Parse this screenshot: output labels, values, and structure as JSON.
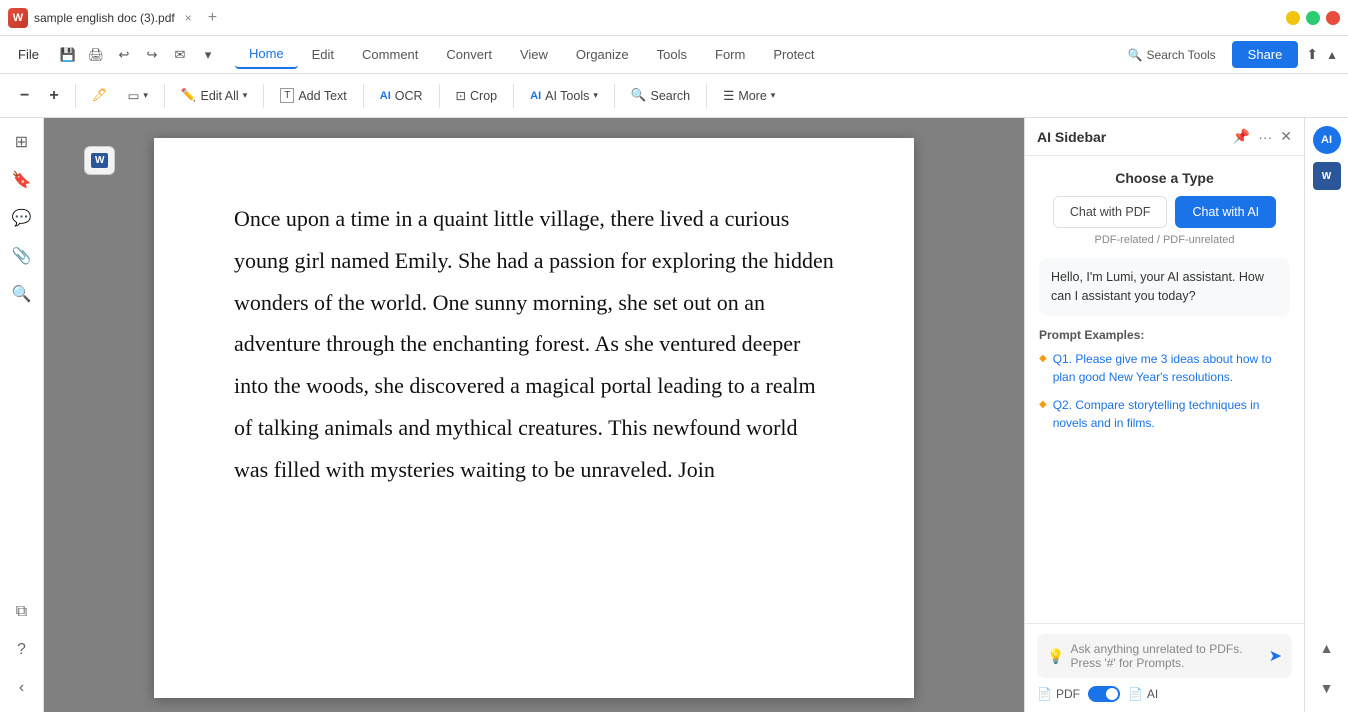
{
  "titlebar": {
    "tab_label": "sample english doc (3).pdf",
    "close_label": "×",
    "add_tab_label": "+",
    "app_icon_text": "W"
  },
  "menubar": {
    "file_label": "File",
    "tabs": [
      {
        "id": "home",
        "label": "Home",
        "active": true
      },
      {
        "id": "edit",
        "label": "Edit",
        "active": false
      },
      {
        "id": "comment",
        "label": "Comment",
        "active": false
      },
      {
        "id": "convert",
        "label": "Convert",
        "active": false
      },
      {
        "id": "view",
        "label": "View",
        "active": false
      },
      {
        "id": "organize",
        "label": "Organize",
        "active": false
      },
      {
        "id": "tools",
        "label": "Tools",
        "active": false
      },
      {
        "id": "form",
        "label": "Form",
        "active": false
      },
      {
        "id": "protect",
        "label": "Protect",
        "active": false
      }
    ],
    "search_tools_label": "Search Tools",
    "share_label": "Share"
  },
  "toolbar": {
    "zoom_out": "−",
    "zoom_in": "+",
    "edit_all_label": "Edit All",
    "add_text_label": "Add Text",
    "ocr_label": "OCR",
    "crop_label": "Crop",
    "ai_tools_label": "AI Tools",
    "search_label": "Search",
    "more_label": "More"
  },
  "ai_sidebar": {
    "title": "AI Sidebar",
    "choose_type_label": "Choose a Type",
    "btn_chat_pdf": "Chat with PDF",
    "btn_chat_ai": "Chat with AI",
    "pdf_unrelated_note": "PDF-related / PDF-unrelated",
    "greeting": "Hello, I'm Lumi, your AI assistant. How can I assistant you today?",
    "prompt_examples_label": "Prompt Examples:",
    "prompts": [
      {
        "id": "q1",
        "label": "Q1. Please give me 3 ideas about how to plan good New Year's resolutions."
      },
      {
        "id": "q2",
        "label": "Q2. Compare storytelling techniques in novels and in films."
      }
    ],
    "input_placeholder": "Ask anything unrelated to PDFs. Press '#' for Prompts.",
    "toggle_pdf_label": "PDF",
    "toggle_ai_label": "AI"
  },
  "pdf": {
    "content": "Once upon a time in a quaint little village, there lived a curious young girl named Emily. She had a passion for exploring the hidden wonders of the world. One sunny morning, she set out on an adventure through the enchanting forest. As she ventured deeper into the woods, she discovered a magical portal leading to a realm of talking animals and mythical creatures. This newfound world was filled with mysteries waiting to be unraveled. Join"
  }
}
